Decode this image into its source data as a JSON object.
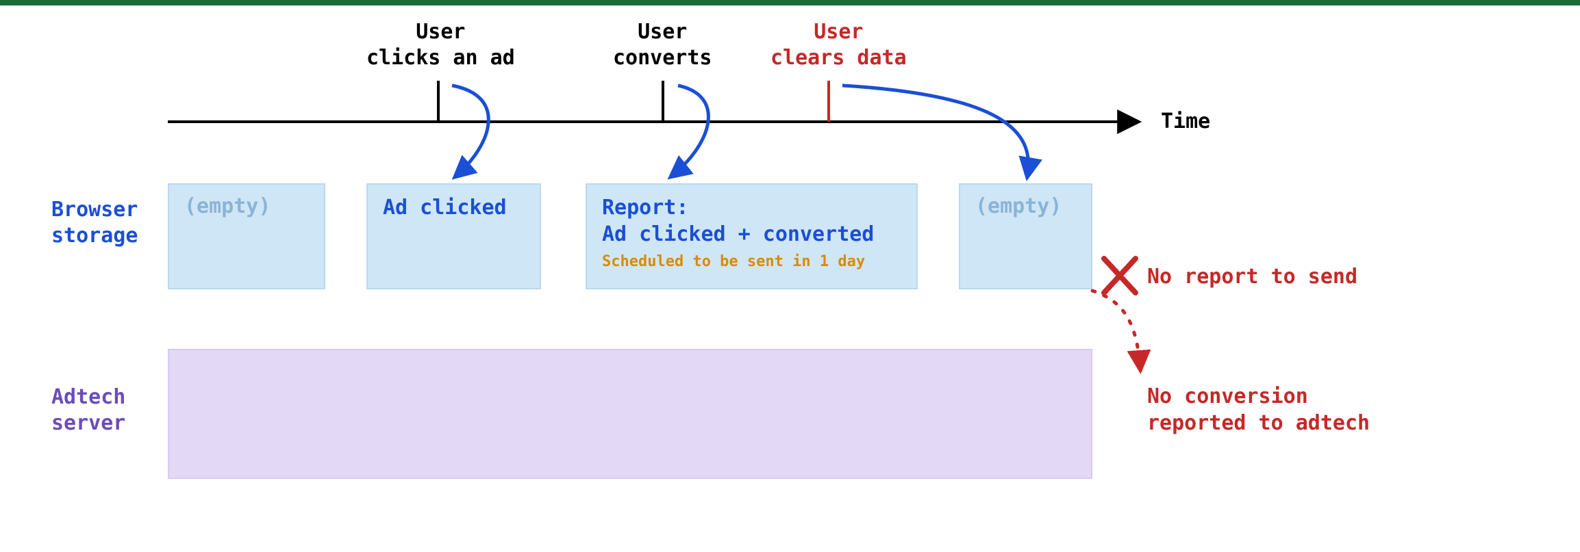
{
  "timeline": {
    "axis_label": "Time",
    "events": [
      {
        "id": "user-clicks",
        "label": "User\nclicks an ad",
        "color": "black"
      },
      {
        "id": "user-converts",
        "label": "User\nconverts",
        "color": "black"
      },
      {
        "id": "user-clears",
        "label": "User\nclears data",
        "color": "red"
      }
    ]
  },
  "rows": {
    "browser_storage": {
      "label": "Browser\nstorage"
    },
    "adtech_server": {
      "label": "Adtech\nserver"
    }
  },
  "storage_states": [
    {
      "id": "empty-1",
      "title": "(empty)",
      "muted": true
    },
    {
      "id": "ad-clicked",
      "title": "Ad clicked"
    },
    {
      "id": "report",
      "title": "Report:\nAd clicked + converted",
      "sub": "Scheduled to be sent in 1 day"
    },
    {
      "id": "empty-2",
      "title": "(empty)",
      "muted": true
    }
  ],
  "errors": {
    "no_report": "No report to send",
    "no_conversion": "No conversion\nreported to adtech"
  }
}
